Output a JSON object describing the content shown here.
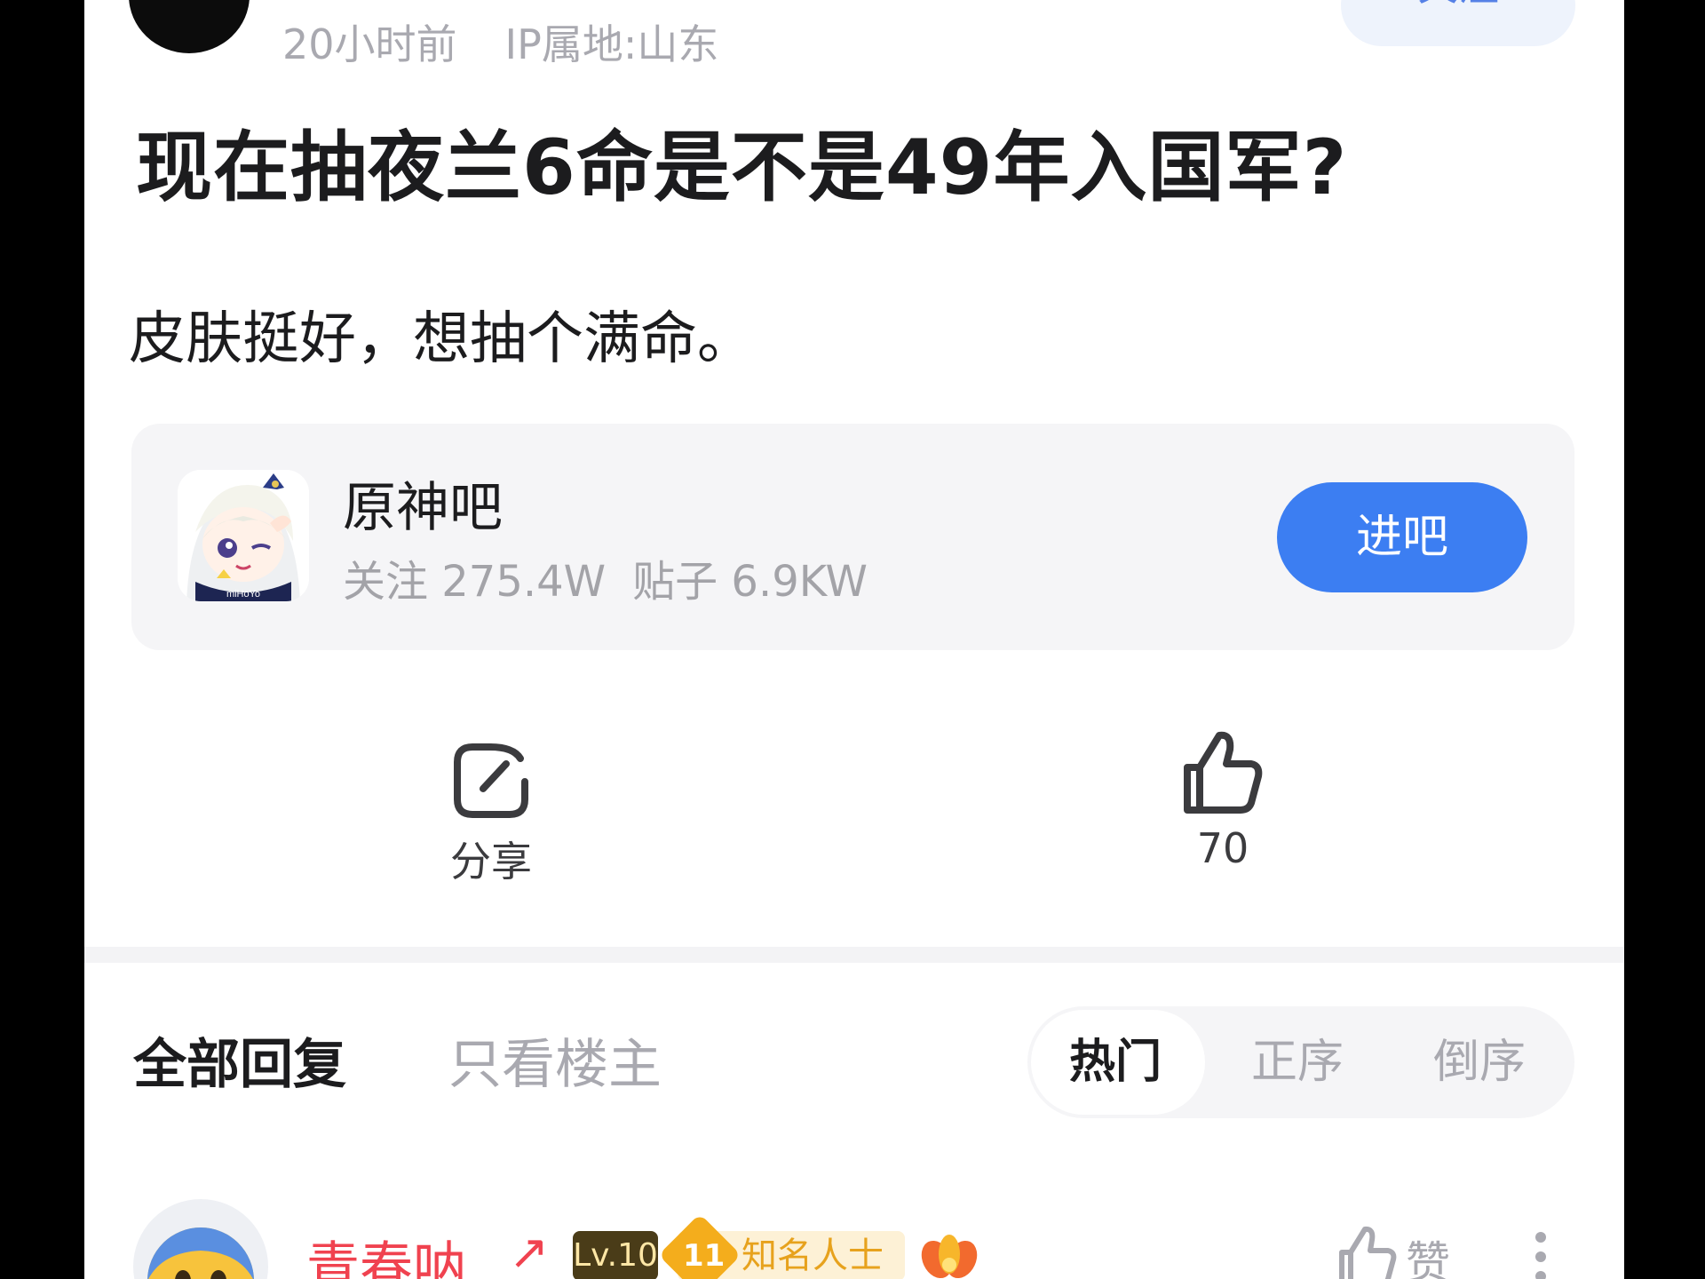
{
  "post": {
    "time": "20小时前",
    "ip_location": "IP属地:山东",
    "follow_label": "关注",
    "title": "现在抽夜兰6命是不是49年入国军?",
    "body": "皮肤挺好，想抽个满命。"
  },
  "forum": {
    "name": "原神吧",
    "followers": "关注 275.4W",
    "posts": "贴子 6.9KW",
    "enter_label": "进吧",
    "avatar_caption": "miHoYo"
  },
  "actions": {
    "share_label": "分享",
    "like_count": "70"
  },
  "replies": {
    "tab_all": "全部回复",
    "tab_op_only": "只看楼主",
    "sort_hot": "热门",
    "sort_asc": "正序",
    "sort_desc": "倒序"
  },
  "comment": {
    "username": "青春呐",
    "arrow": "↗",
    "level": "Lv.10",
    "fame_level": "11",
    "fame_title": "知名人士",
    "like_label": "赞"
  },
  "colors": {
    "accent": "#3c7ef2",
    "username": "#f0424f",
    "muted": "#a9a9b0"
  }
}
